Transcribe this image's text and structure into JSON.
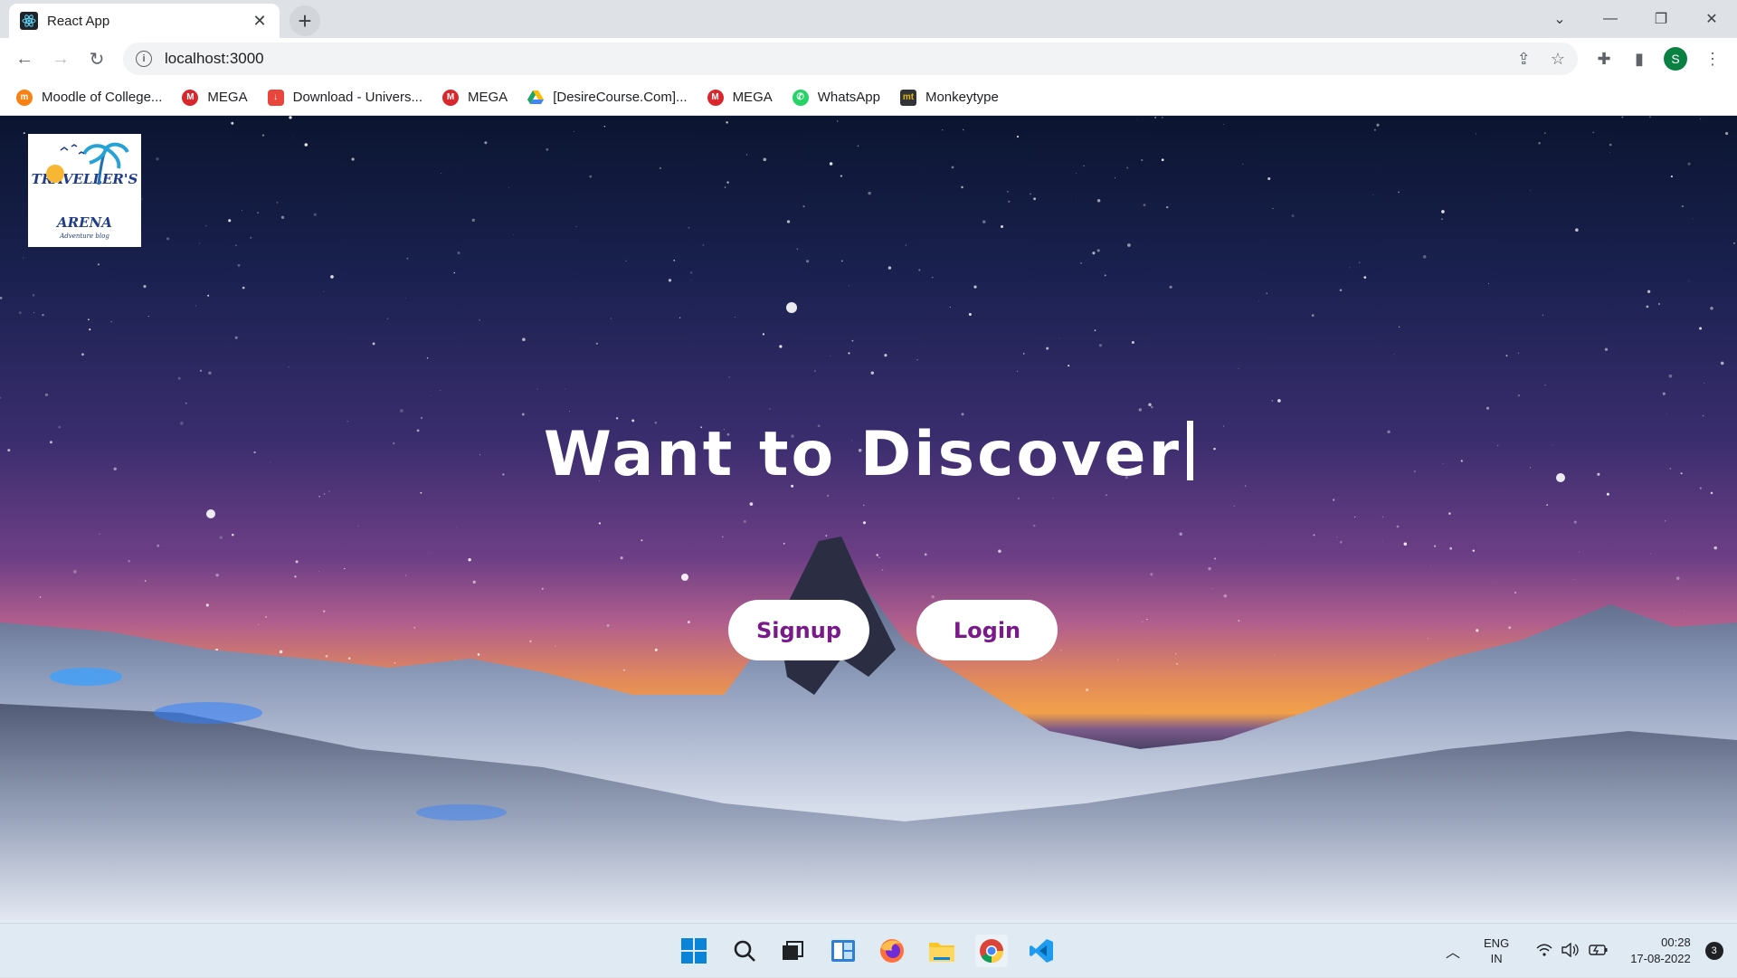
{
  "browser": {
    "tab_title": "React App",
    "tab_close": "✕",
    "new_tab": "+",
    "url": "localhost:3000",
    "profile_initial": "S"
  },
  "bookmarks": [
    {
      "label": "Moodle of College...",
      "icon": "moodle-icon",
      "color": "#f98012"
    },
    {
      "label": "MEGA",
      "icon": "mega-icon",
      "color": "#d9272e"
    },
    {
      "label": "Download - Univers...",
      "icon": "download-icon",
      "color": "#e8453c"
    },
    {
      "label": "MEGA",
      "icon": "mega-icon",
      "color": "#d9272e"
    },
    {
      "label": "[DesireCourse.Com]...",
      "icon": "google-drive-icon",
      "color": "#1fa463"
    },
    {
      "label": "MEGA",
      "icon": "mega-icon",
      "color": "#d9272e"
    },
    {
      "label": "WhatsApp",
      "icon": "whatsapp-icon",
      "color": "#25d366"
    },
    {
      "label": "Monkeytype",
      "icon": "monkeytype-icon",
      "color": "#323437"
    }
  ],
  "page": {
    "logo_line1": "TRAVELLER'S",
    "logo_line2": "ARENA",
    "logo_tagline": "Adventure blog",
    "headline": "Want to Discover",
    "signup_label": "Signup",
    "login_label": "Login",
    "accent_color": "#7a1a8a"
  },
  "taskbar": {
    "language": "ENG",
    "region": "IN",
    "time": "00:28",
    "date": "17-08-2022",
    "notification_count": "3"
  }
}
